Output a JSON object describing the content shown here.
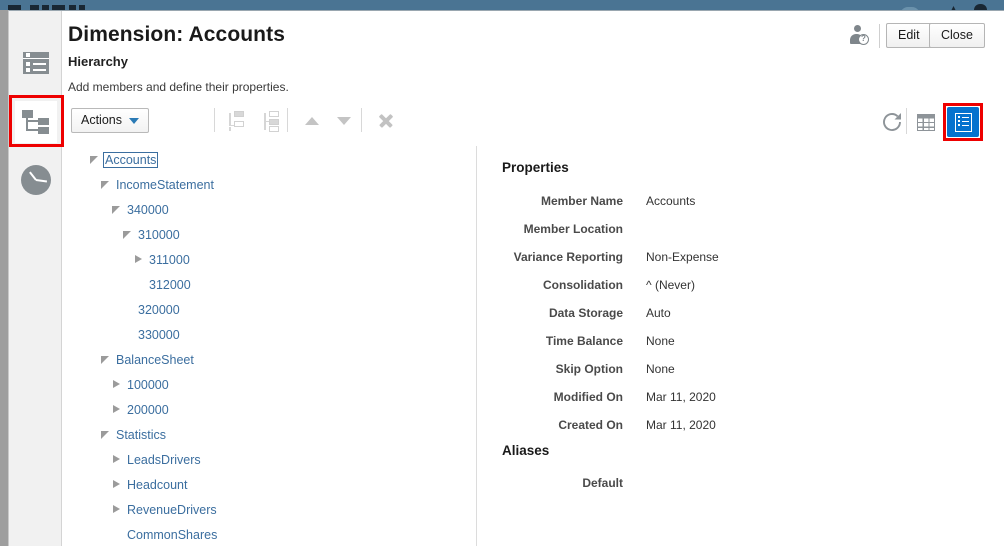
{
  "app_bar": {
    "present": true
  },
  "sidebar": {
    "items": [
      {
        "name": "dimension-details-icon",
        "icon": "form-list-icon",
        "active": false
      },
      {
        "name": "hierarchy-icon",
        "icon": "hierarchy-tree-icon",
        "active": true
      },
      {
        "name": "pending-jobs-icon",
        "icon": "clock-icon",
        "active": false
      }
    ]
  },
  "header": {
    "title": "Dimension: Accounts",
    "section": "Hierarchy",
    "subtitle": "Add members and define their properties.",
    "user_help_icon": "user-help-icon",
    "user_help_badge": "?",
    "edit_label": "Edit",
    "close_label": "Close"
  },
  "toolbar": {
    "actions_label": "Actions",
    "icons": [
      {
        "name": "add-sibling-icon",
        "title": "Add Sibling",
        "enabled": false
      },
      {
        "name": "add-child-icon",
        "title": "Add Child",
        "enabled": false
      },
      {
        "name": "move-up-icon",
        "title": "Move Up",
        "enabled": false
      },
      {
        "name": "move-down-icon",
        "title": "Move Down",
        "enabled": false
      },
      {
        "name": "delete-icon",
        "title": "Delete",
        "enabled": false
      }
    ],
    "refresh_icon": "refresh-icon",
    "grid_icon": "grid-view-icon",
    "properties_toggle_icon": "properties-panel-icon",
    "properties_toggle_active": true
  },
  "tree": {
    "rows": [
      {
        "label": "Accounts",
        "depth": 0,
        "state": "expanded",
        "selected": true
      },
      {
        "label": "IncomeStatement",
        "depth": 1,
        "state": "expanded",
        "selected": false
      },
      {
        "label": "340000",
        "depth": 2,
        "state": "expanded",
        "selected": false
      },
      {
        "label": "310000",
        "depth": 3,
        "state": "expanded",
        "selected": false
      },
      {
        "label": "311000",
        "depth": 4,
        "state": "collapsed",
        "selected": false
      },
      {
        "label": "312000",
        "depth": 4,
        "state": "none",
        "selected": false
      },
      {
        "label": "320000",
        "depth": 3,
        "state": "none",
        "selected": false
      },
      {
        "label": "330000",
        "depth": 3,
        "state": "none",
        "selected": false
      },
      {
        "label": "BalanceSheet",
        "depth": 1,
        "state": "expanded",
        "selected": false
      },
      {
        "label": "100000",
        "depth": 2,
        "state": "collapsed",
        "selected": false
      },
      {
        "label": "200000",
        "depth": 2,
        "state": "collapsed",
        "selected": false
      },
      {
        "label": "Statistics",
        "depth": 1,
        "state": "expanded",
        "selected": false
      },
      {
        "label": "LeadsDrivers",
        "depth": 2,
        "state": "collapsed",
        "selected": false
      },
      {
        "label": "Headcount",
        "depth": 2,
        "state": "collapsed",
        "selected": false
      },
      {
        "label": "RevenueDrivers",
        "depth": 2,
        "state": "collapsed",
        "selected": false
      },
      {
        "label": "CommonShares",
        "depth": 2,
        "state": "none",
        "selected": false
      }
    ]
  },
  "properties": {
    "heading": "Properties",
    "rows": [
      {
        "label": "Member Name",
        "value": "Accounts"
      },
      {
        "label": "Member Location",
        "value": ""
      },
      {
        "label": "Variance Reporting",
        "value": "Non-Expense"
      },
      {
        "label": "Consolidation",
        "value": "^ (Never)"
      },
      {
        "label": "Data Storage",
        "value": "Auto"
      },
      {
        "label": "Time Balance",
        "value": "None"
      },
      {
        "label": "Skip Option",
        "value": "None"
      },
      {
        "label": "Modified On",
        "value": "Mar 11, 2020"
      },
      {
        "label": "Created On",
        "value": "Mar 11, 2020"
      }
    ]
  },
  "aliases": {
    "heading": "Aliases",
    "rows": [
      {
        "label": "Default",
        "value": ""
      }
    ]
  },
  "colors": {
    "link": "#3b6e9f",
    "accent": "#0572ce",
    "annotation": "#ee0000",
    "app_bar": "#4a7493",
    "icon_gray": "#868d91"
  }
}
